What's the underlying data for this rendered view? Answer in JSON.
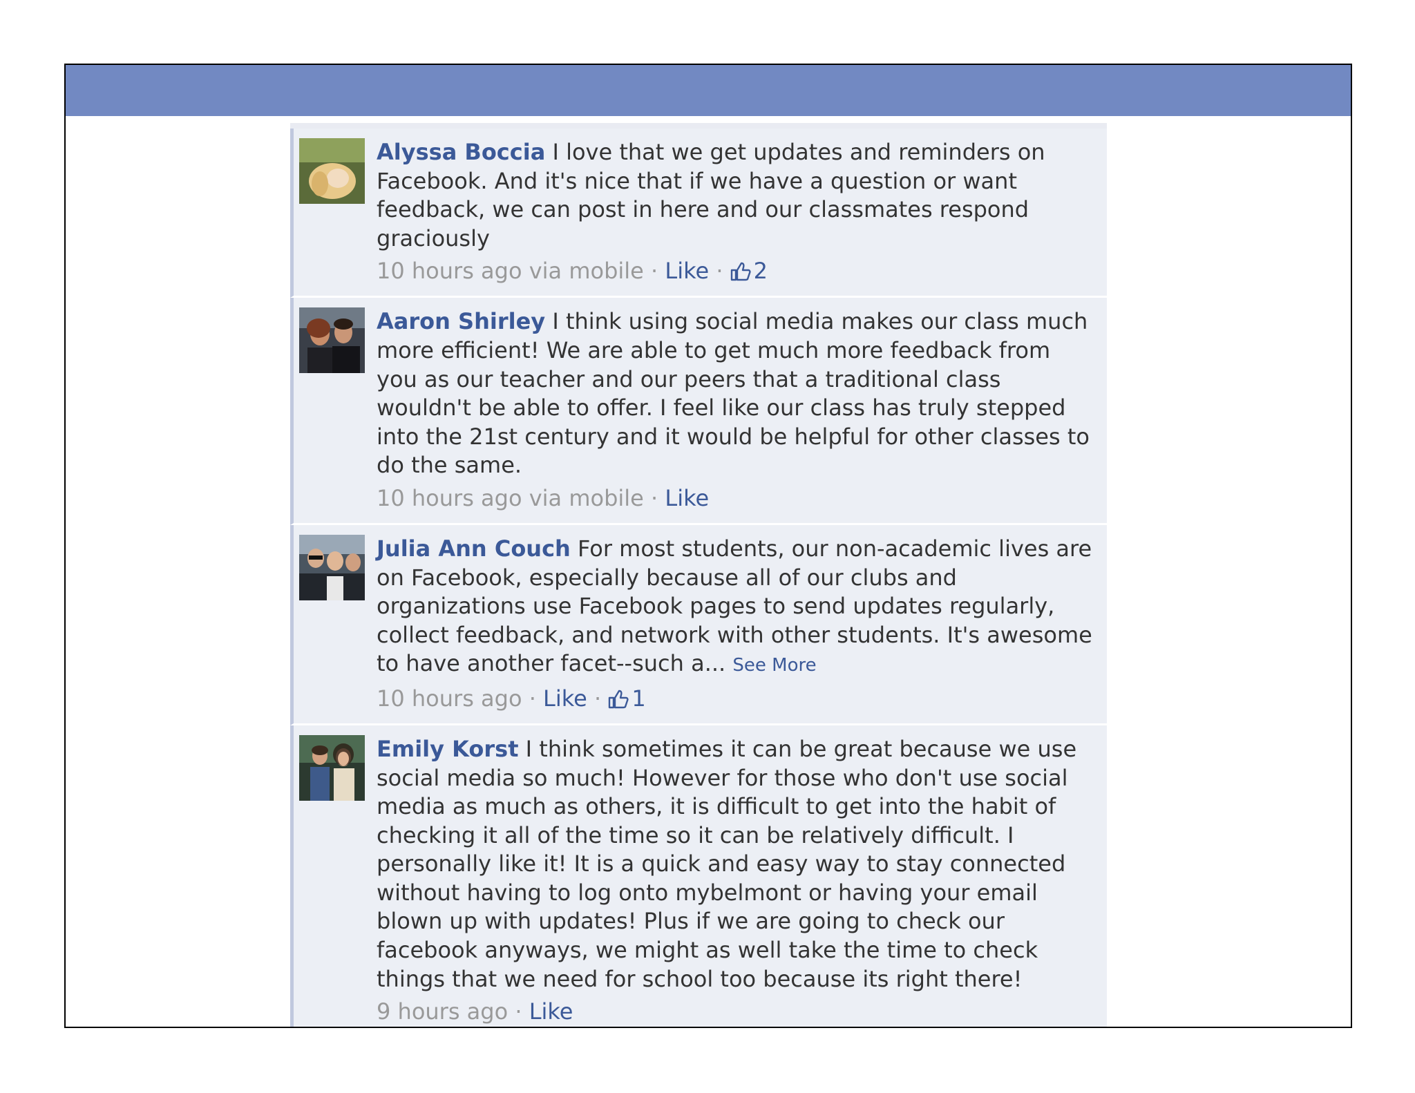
{
  "comments": [
    {
      "author": "Alyssa Boccia",
      "text": " I love that we get updates and reminders on Facebook. And it's nice that if we have a question or want feedback, we can post in here and our classmates respond graciously",
      "time": "10 hours ago via mobile",
      "sep1": " · ",
      "like": "Like",
      "sep2": " · ",
      "like_count": "2"
    },
    {
      "author": "Aaron Shirley",
      "text": " I think using social media makes our class much more efficient! We are able to get much more feedback from you as our teacher and our peers that a traditional class wouldn't be able to offer. I feel like our class has truly stepped into the 21st century and it would be helpful for other classes to do the same.",
      "time": "10 hours ago via mobile",
      "sep1": " · ",
      "like": "Like"
    },
    {
      "author": "Julia Ann Couch",
      "text": " For most students, our non-academic lives are on Facebook, especially because all of our clubs and organizations use Facebook pages to send updates regularly, collect feedback, and network with other students. It's awesome to have another facet--such a... ",
      "see_more": "See More",
      "time": "10 hours ago",
      "sep1": " · ",
      "like": "Like",
      "sep2": " · ",
      "like_count": "1"
    },
    {
      "author": "Emily Korst",
      "text": " I think sometimes it can be great because we use social media so much! However for those who don't use social media as much as others, it is difficult to get into the habit of checking it all of the time so it can be relatively difficult. I personally like it! It is a quick and easy way to stay connected without having to log onto mybelmont or having your email blown up with updates! Plus if we are going to check our facebook anyways, we might as well take the time to check things that we need for school too because its right there!",
      "time": "9 hours ago",
      "sep1": " · ",
      "like": "Like"
    }
  ],
  "icons": {
    "like_count": "thumbs-up-icon"
  },
  "colors": {
    "header_bar": "#7289c2",
    "link": "#3b5998",
    "comment_bg": "#eceff5"
  }
}
